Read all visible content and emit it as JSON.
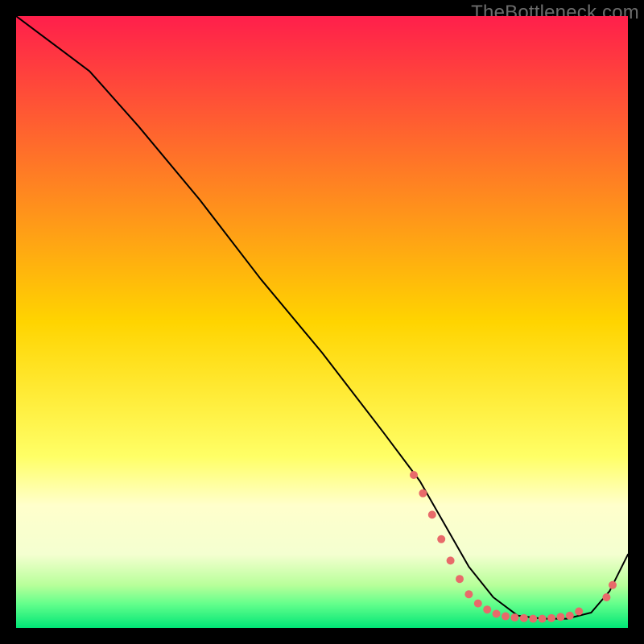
{
  "watermark": "TheBottleneck.com",
  "chart_data": {
    "type": "line",
    "title": "",
    "xlabel": "",
    "ylabel": "",
    "xlim": [
      0,
      100
    ],
    "ylim": [
      0,
      100
    ],
    "grid": false,
    "legend": false,
    "background_gradient": {
      "stops": [
        {
          "offset": 0.0,
          "color": "#ff1f4b"
        },
        {
          "offset": 0.5,
          "color": "#ffd400"
        },
        {
          "offset": 0.72,
          "color": "#ffff66"
        },
        {
          "offset": 0.8,
          "color": "#ffffcc"
        },
        {
          "offset": 0.88,
          "color": "#f4ffd0"
        },
        {
          "offset": 0.93,
          "color": "#b8ff9a"
        },
        {
          "offset": 0.96,
          "color": "#66ff8c"
        },
        {
          "offset": 1.0,
          "color": "#00e676"
        }
      ]
    },
    "series": [
      {
        "name": "bottleneck-curve",
        "color": "#000000",
        "width": 2,
        "x": [
          0,
          4,
          8,
          12,
          20,
          30,
          40,
          50,
          60,
          66,
          70,
          74,
          78,
          82,
          86,
          90,
          94,
          97,
          100
        ],
        "y": [
          100,
          97,
          94,
          91,
          82,
          70,
          57,
          45,
          32,
          24,
          17,
          10,
          5,
          2,
          1.5,
          1.5,
          2.5,
          6,
          12
        ]
      }
    ],
    "scatter": {
      "name": "highlight-dots",
      "color": "#e86a6a",
      "radius": 5,
      "points": [
        {
          "x": 65.0,
          "y": 25.0
        },
        {
          "x": 66.5,
          "y": 22.0
        },
        {
          "x": 68.0,
          "y": 18.5
        },
        {
          "x": 69.5,
          "y": 14.5
        },
        {
          "x": 71.0,
          "y": 11.0
        },
        {
          "x": 72.5,
          "y": 8.0
        },
        {
          "x": 74.0,
          "y": 5.5
        },
        {
          "x": 75.5,
          "y": 4.0
        },
        {
          "x": 77.0,
          "y": 3.0
        },
        {
          "x": 78.5,
          "y": 2.3
        },
        {
          "x": 80.0,
          "y": 1.9
        },
        {
          "x": 81.5,
          "y": 1.7
        },
        {
          "x": 83.0,
          "y": 1.6
        },
        {
          "x": 84.5,
          "y": 1.5
        },
        {
          "x": 86.0,
          "y": 1.5
        },
        {
          "x": 87.5,
          "y": 1.6
        },
        {
          "x": 89.0,
          "y": 1.8
        },
        {
          "x": 90.5,
          "y": 2.0
        },
        {
          "x": 92.0,
          "y": 2.7
        },
        {
          "x": 96.5,
          "y": 5.0
        },
        {
          "x": 97.5,
          "y": 7.0
        }
      ]
    }
  }
}
